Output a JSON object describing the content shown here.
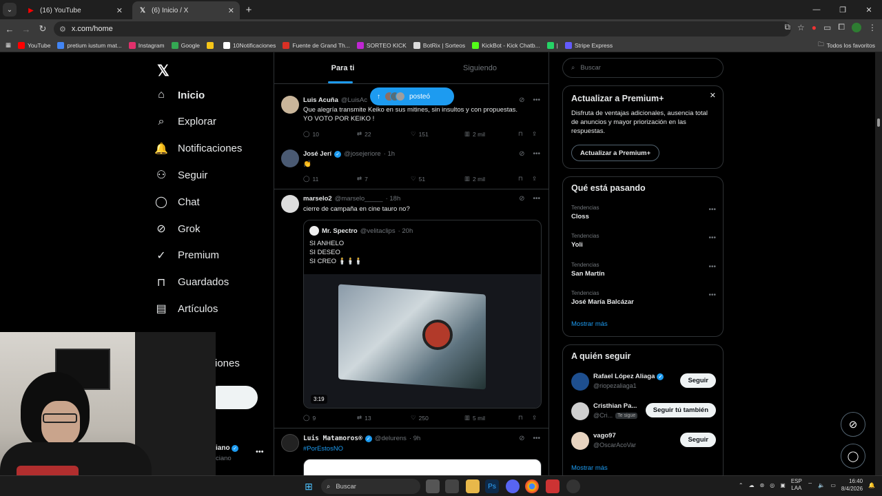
{
  "browser": {
    "tabs": [
      {
        "title": "(16) YouTube",
        "icon": "youtube-icon",
        "active": false
      },
      {
        "title": "(6) Inicio / X",
        "icon": "x-logo-icon",
        "active": true
      }
    ],
    "url": "x.com/home",
    "bookmarks": [
      {
        "label": "YouTube",
        "color": "#ff0000"
      },
      {
        "label": "pretium iustum mat...",
        "color": "#4285f4"
      },
      {
        "label": "Instagram",
        "color": "#e1306c"
      },
      {
        "label": "Google",
        "color": "#34a853"
      },
      {
        "label": "",
        "color": "#f5c518"
      },
      {
        "label": "10Notificaciones",
        "color": "#ffffff"
      },
      {
        "label": "Fuente de Grand Th...",
        "color": "#d93025"
      },
      {
        "label": "SORTEO KICK",
        "color": "#c026d3"
      },
      {
        "label": "BotRix | Sorteos",
        "color": "#dddddd"
      },
      {
        "label": "KickBot - Kick Chatb...",
        "color": "#53fc18"
      },
      {
        "label": "|",
        "color": "#25d366"
      },
      {
        "label": "Stripe Express",
        "color": "#635bff"
      }
    ],
    "all_bookmarks": "Todos los favoritos"
  },
  "nav": {
    "items": [
      {
        "label": "Inicio",
        "icon": "home-icon",
        "bold": true
      },
      {
        "label": "Explorar",
        "icon": "search-icon",
        "bold": false
      },
      {
        "label": "Notificaciones",
        "icon": "bell-icon",
        "bold": false
      },
      {
        "label": "Seguir",
        "icon": "add-person-icon",
        "bold": false
      },
      {
        "label": "Chat",
        "icon": "chat-icon",
        "bold": false
      },
      {
        "label": "Grok",
        "icon": "grok-icon",
        "bold": false
      },
      {
        "label": "Premium",
        "icon": "premium-icon",
        "bold": false
      },
      {
        "label": "Guardados",
        "icon": "bookmark-icon",
        "bold": false
      },
      {
        "label": "Artículos",
        "icon": "articles-icon",
        "bold": false
      }
    ],
    "partial_more": "iones",
    "partial_post": "r",
    "account_partial_name": "iano",
    "account_partial_handle": "ciano"
  },
  "feed": {
    "tabs": [
      "Para ti",
      "Siguiendo"
    ],
    "new_posts_pill": "posteó",
    "tweets": [
      {
        "name": "Luis Acuña",
        "handle": "@LuisAc",
        "time": "",
        "text": [
          "Que alegría transmite Keiko en sus mitines, sin insultos y con propuestas.",
          "YO VOTO POR KEIKO !"
        ],
        "replies": "10",
        "reposts": "22",
        "likes": "151",
        "views": "2 mil"
      },
      {
        "name": "José Jerí",
        "handle": "@josejeriore",
        "time": "· 1h",
        "verified": true,
        "text": [
          "👏"
        ],
        "replies": "11",
        "reposts": "7",
        "likes": "51",
        "views": "2 mil"
      },
      {
        "name": "marselo2",
        "handle": "@marselo_____",
        "time": "· 18h",
        "text": [
          "cierre de campaña en cine tauro no?"
        ],
        "quote": {
          "name": "Mr. Spectro",
          "handle": "@velitaclips",
          "time": "· 20h",
          "lines": [
            "SI ANHELO",
            "SI DESEO",
            "SI CREO 🕯️🕯️🕯️"
          ],
          "video_time": "3:19"
        },
        "replies": "9",
        "reposts": "13",
        "likes": "250",
        "views": "5 mil"
      },
      {
        "name": "Luis Matamoros®",
        "handle": "@delurens",
        "time": "· 9h",
        "verified": true,
        "text": [
          "#PorEstosNO"
        ]
      }
    ]
  },
  "right": {
    "search_placeholder": "Buscar",
    "premium": {
      "title": "Actualizar a Premium+",
      "text": "Disfruta de ventajas adicionales, ausencia total de anuncios y mayor priorización en las respuestas.",
      "button": "Actualizar a Premium+"
    },
    "trends_title": "Qué está pasando",
    "trends": [
      {
        "category": "Tendencias",
        "name": "Closs"
      },
      {
        "category": "Tendencias",
        "name": "Yoli"
      },
      {
        "category": "Tendencias",
        "name": "San Martín"
      },
      {
        "category": "Tendencias",
        "name": "José María Balcázar"
      }
    ],
    "show_more": "Mostrar más",
    "follow_title": "A quién seguir",
    "follow": [
      {
        "name": "Rafael López Aliaga",
        "handle": "@riopezaliaga1",
        "button": "Seguir",
        "verified": true
      },
      {
        "name": "Cristhian Pa...",
        "handle": "@Cri...",
        "badge": "Te sigue",
        "button": "Seguir tú también"
      },
      {
        "name": "vago97",
        "handle": "@OscarAcoVar",
        "button": "Seguir"
      }
    ],
    "follow_more": "Mostrar más"
  },
  "taskbar": {
    "search": "Buscar",
    "lang": "ESP",
    "lang2": "LAA",
    "time": "16:40",
    "date": "8/4/2026"
  }
}
